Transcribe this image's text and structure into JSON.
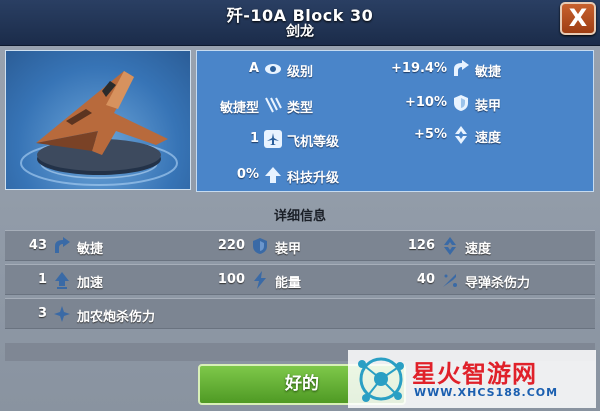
{
  "title": {
    "main": "歼-10A Block 30",
    "sub": "剑龙",
    "close_label": "X"
  },
  "summary": {
    "left": [
      {
        "value": "A",
        "icon": "eye-icon",
        "label": "级别"
      },
      {
        "value": "敏捷型",
        "icon": "claw-icon",
        "label": "类型"
      },
      {
        "value": "1",
        "icon": "plane-icon",
        "label": "飞机等级"
      },
      {
        "value": "0%",
        "icon": "upgrade-arrow-icon",
        "label": "科技升级"
      }
    ],
    "right": [
      {
        "value": "+19.4%",
        "icon": "agility-icon",
        "label": "敏捷"
      },
      {
        "value": "+10%",
        "icon": "shield-icon",
        "label": "装甲"
      },
      {
        "value": "+5%",
        "icon": "speed-icon",
        "label": "速度"
      }
    ]
  },
  "details": {
    "title": "详细信息",
    "rows": [
      [
        {
          "value": "43",
          "icon": "agility-icon",
          "label": "敏捷"
        },
        {
          "value": "220",
          "icon": "shield-icon",
          "label": "装甲"
        },
        {
          "value": "126",
          "icon": "speed-icon",
          "label": "速度"
        }
      ],
      [
        {
          "value": "1",
          "icon": "acceleration-icon",
          "label": "加速"
        },
        {
          "value": "100",
          "icon": "lightning-icon",
          "label": "能量"
        },
        {
          "value": "40",
          "icon": "missile-icon",
          "label": "导弹杀伤力"
        }
      ],
      [
        {
          "value": "3",
          "icon": "cannon-icon",
          "label": "加农炮杀伤力"
        }
      ]
    ]
  },
  "ok_button": "好的",
  "watermark": {
    "text": "星火智游网",
    "url": "WWW.XHCS188.COM"
  },
  "colors": {
    "stats_panel": "#4a85c9",
    "ok_button": "#5fae30",
    "close_button": "#b24f21"
  }
}
